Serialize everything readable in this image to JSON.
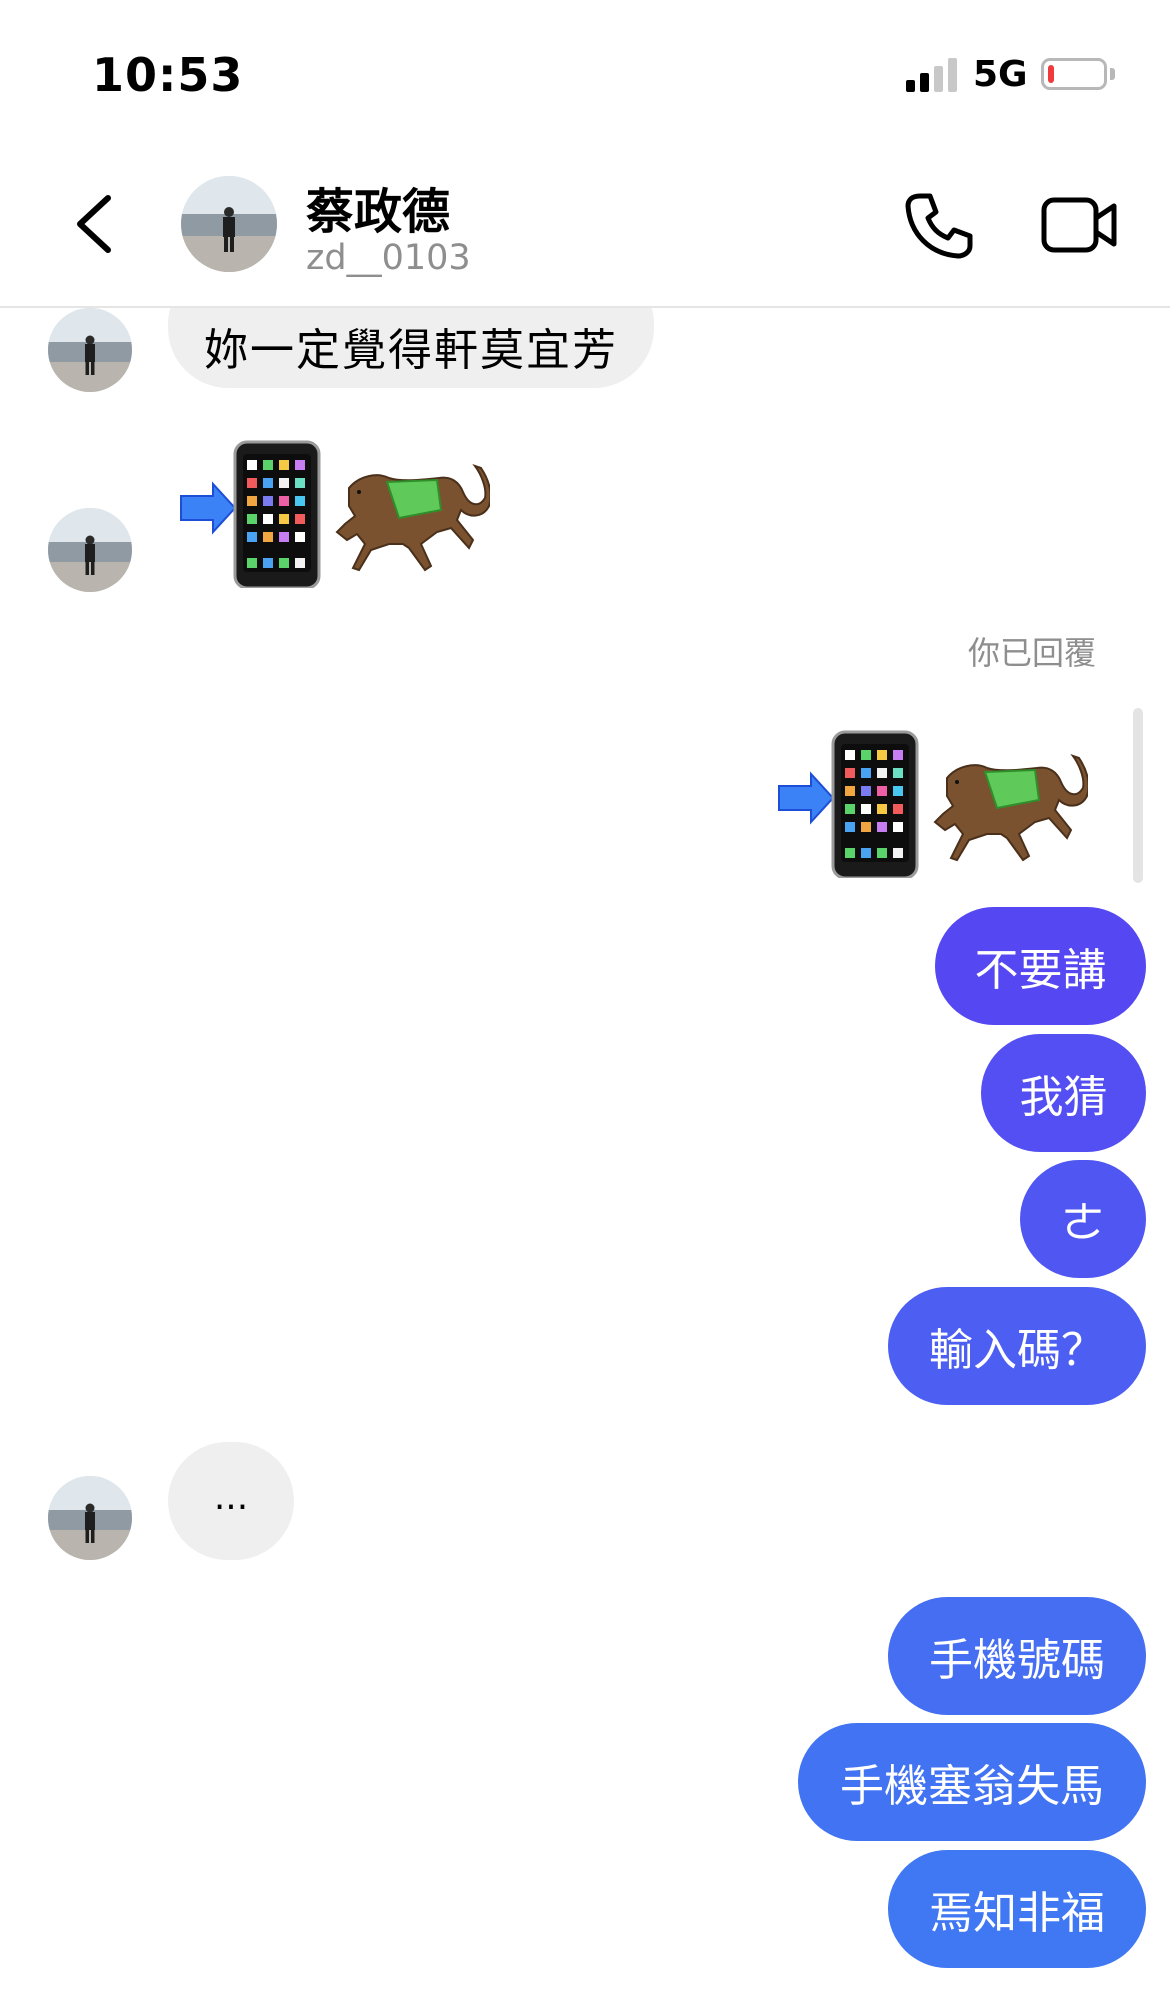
{
  "status_bar": {
    "time": "10:53",
    "network": "5G",
    "signal_bars": 2,
    "battery_level": 0.1
  },
  "header": {
    "contact_name": "蔡政德",
    "contact_handle": "zd__0103",
    "icons": [
      "chevron-left-icon",
      "avatar",
      "phone-icon",
      "video-camera-icon"
    ]
  },
  "messages": {
    "partial_incoming": "妳一定覺得軒莫宜芳",
    "emoji_pair": [
      "arrow-right-emoji",
      "mobile-phone-emoji",
      "horse-racing-emoji"
    ],
    "reply_label": "你已回覆",
    "outgoing_1": "不要講",
    "outgoing_2": "我猜",
    "outgoing_3": "ㄜ",
    "outgoing_4": "輸入碼？",
    "typing": "...",
    "outgoing_5": "手機號碼",
    "outgoing_6": "手機塞翁失馬",
    "outgoing_7": "焉知非福"
  },
  "colors": {
    "bubble_in": "#efefef",
    "gradient_top": "#5a3ff2",
    "gradient_bottom": "#3d7cf2",
    "text_secondary": "#8e8e8e"
  }
}
